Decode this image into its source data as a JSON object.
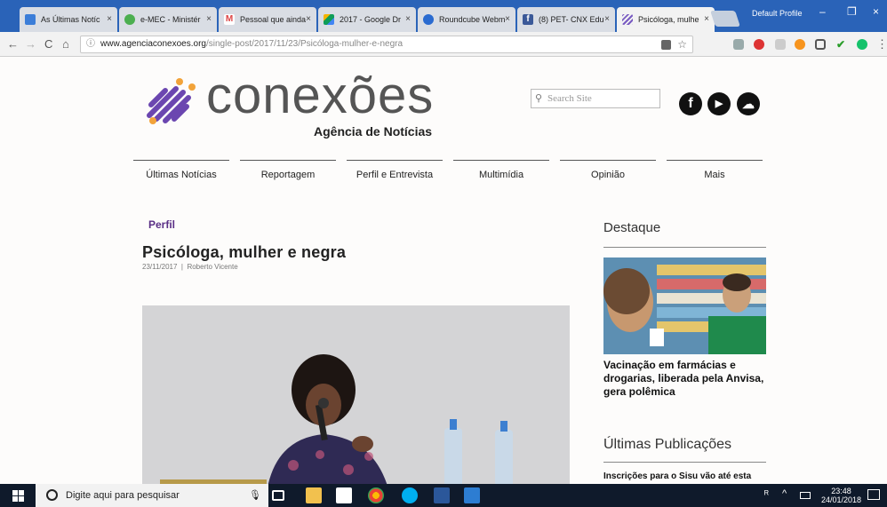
{
  "browser": {
    "tabs": [
      {
        "label": "As Últimas Notíc",
        "color": "#3b7dd8"
      },
      {
        "label": "e-MEC - Ministér",
        "color": "#4caf50"
      },
      {
        "label": "Pessoal que ainda",
        "color": "#d44"
      },
      {
        "label": "2017 - Google Dr",
        "color": "#f4b400"
      },
      {
        "label": "Roundcube Webm",
        "color": "#2a6bd0"
      },
      {
        "label": "(8) PET- CNX Edu",
        "color": "#3b5998"
      },
      {
        "label": "Psicóloga, mulhe",
        "color": "#7a5cc2"
      }
    ],
    "tab_close": "×",
    "profile": "Default Profile",
    "window_controls": [
      "–",
      "❐",
      "×"
    ],
    "nav": {
      "back": "←",
      "forward": "→",
      "reload": "C",
      "home": "⌂"
    },
    "url_info": "ⓘ",
    "url_domain": "www.agenciaconexoes.org",
    "url_path": "/single-post/2017/11/23/Psicóloga-mulher-e-negra",
    "toolbar_icons": [
      "translate-icon",
      "star-icon",
      "extension-icon",
      "adblock-icon",
      "pin-icon",
      "play-icon",
      "cast-icon",
      "check-icon",
      "grammarly-icon",
      "menu-icon"
    ],
    "star": "☆",
    "menu_dots": "⋮"
  },
  "site": {
    "logo_text": "conexões",
    "logo_subtitle": "Agência de Notícias",
    "search_placeholder": "Search Site",
    "search_icon": "🔍",
    "social": [
      {
        "name": "facebook-icon",
        "glyph": "f"
      },
      {
        "name": "youtube-icon",
        "glyph": "▶"
      },
      {
        "name": "soundcloud-icon",
        "glyph": "☁"
      }
    ],
    "menu": [
      "Últimas Notícias",
      "Reportagem",
      "Perfil e Entrevista",
      "Multimídia",
      "Opinião",
      "Mais"
    ],
    "post": {
      "section": "Perfil",
      "title": "Psicóloga, mulher e negra",
      "date": "23/11/2017",
      "separator": "|",
      "author": "Roberto Vicente"
    },
    "aside": {
      "featured_heading": "Destaque",
      "featured_title": "Vacinação em farmácias e drogarias, liberada pela Anvisa, gera polêmica",
      "latest_heading": "Últimas Publicações",
      "latest_first": "Inscrições para o Sisu vão até esta"
    }
  },
  "taskbar": {
    "search_placeholder": "Digite aqui para pesquisar",
    "time": "23:48",
    "date": "24/01/2018"
  }
}
